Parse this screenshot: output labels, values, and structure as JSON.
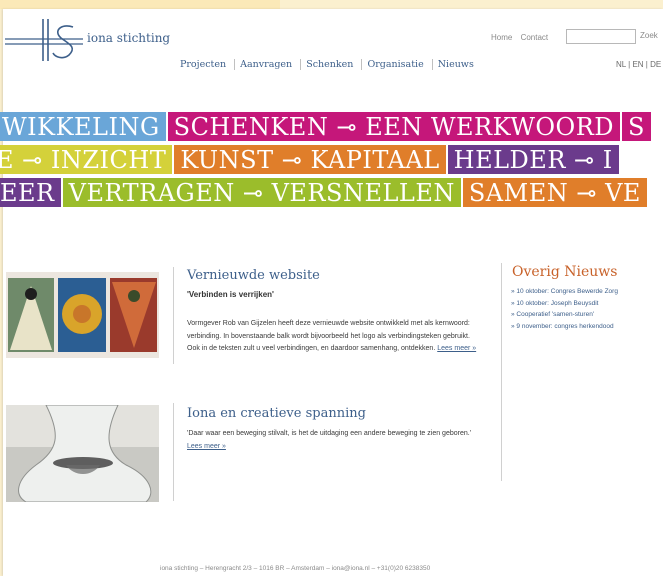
{
  "site": {
    "name": "iona stichting"
  },
  "header": {
    "links": [
      "Home",
      "Contact"
    ],
    "search_placeholder": "",
    "search_label": "Zoek",
    "nav": [
      "Projecten",
      "Aanvragen",
      "Schenken",
      "Organisatie",
      "Nieuws"
    ],
    "lang": "NL | EN | DE"
  },
  "banner": {
    "rows": [
      [
        {
          "text": "WIKKELING",
          "color": "#6aa6d8"
        },
        {
          "text": "SCHENKEN ⊸ EEN WERKWOORD",
          "color": "#c5177a"
        },
        {
          "text": "S",
          "color": "#c5177a"
        }
      ],
      [
        {
          "text": "E ⊸ INZICHT",
          "color": "#d4d13a"
        },
        {
          "text": "KUNST ⊸ KAPITAAL",
          "color": "#e07e2a"
        },
        {
          "text": "HELDER ⊸ I",
          "color": "#6b3b8c"
        }
      ],
      [
        {
          "text": "EER",
          "color": "#6b3b8c"
        },
        {
          "text": "VERTRAGEN ⊸ VERSNELLEN",
          "color": "#9bbd2b"
        },
        {
          "text": "SAMEN ⊸ VE",
          "color": "#e07e2a"
        }
      ]
    ]
  },
  "articles": [
    {
      "title": "Vernieuwde website",
      "subtitle": "'Verbinden is verrijken'",
      "body": "Vormgever Rob van Gijzelen heeft deze vernieuwde website ontwikkeld met als kernwoord: verbinding. In bovenstaande balk wordt bijvoorbeeld het logo als verbindingsteken gebruikt. Ook in de teksten zult u veel verbindingen, en daardoor samenhang, ontdekken.",
      "more": "Lees meer »"
    },
    {
      "title": "Iona en creatieve spanning",
      "subtitle": "",
      "body": "'Daar waar een beweging stilvalt, is het de uitdaging een andere beweging te zien geboren.'",
      "more": "Lees meer »"
    }
  ],
  "sidebar": {
    "title": "Overig Nieuws",
    "items": [
      "» 10 oktober: Congres Bewerde Zorg",
      "» 10 oktober: Joseph Beuysdit",
      "» Cooperatief 'samen-sturen'",
      "» 9 november: congres herkendood"
    ]
  },
  "footer": {
    "text": "iona stichting – Herengracht 2/3 – 1016 BR – Amsterdam – iona@iona.nl – +31(0)20 6238350"
  }
}
